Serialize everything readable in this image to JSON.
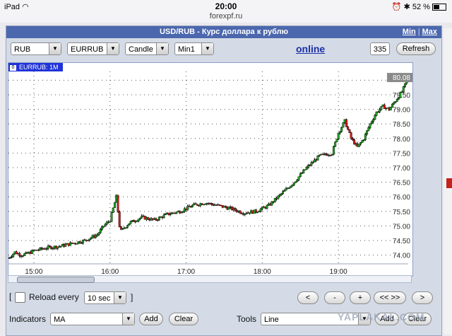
{
  "statusbar": {
    "device": "iPad",
    "time": "20:00",
    "url": "forexpf.ru",
    "battery": "52 %"
  },
  "window": {
    "title": "USD/RUB - Курс доллара к рублю",
    "min_link": "Min",
    "max_link": "Max"
  },
  "toolbar": {
    "selects": [
      {
        "name": "currency-select",
        "value": "RUB"
      },
      {
        "name": "pair-select",
        "value": "EURRUB"
      },
      {
        "name": "chart-type-select",
        "value": "Candle"
      },
      {
        "name": "timeframe-select",
        "value": "Min1"
      }
    ],
    "online_label": "online",
    "bars_count": "335",
    "refresh_label": "Refresh"
  },
  "chart": {
    "instrument_label": "EURRUB: 1M",
    "instrument_box": "0",
    "last_price": "80.08"
  },
  "chart_data": {
    "type": "candlestick",
    "x_ticks": [
      "15:00",
      "16:00",
      "17:00",
      "18:00",
      "19:00"
    ],
    "y_ticks": [
      "74.00",
      "74.50",
      "75.00",
      "75.50",
      "76.00",
      "76.50",
      "77.00",
      "77.50",
      "78.00",
      "78.50",
      "79.00",
      "79.50",
      "80.00"
    ],
    "ylim": [
      73.7,
      80.3
    ],
    "x_range": [
      "14:40",
      "19:55"
    ],
    "grid": true,
    "last_price": 80.08,
    "price_path": [
      [
        "14:40",
        73.9
      ],
      [
        "14:45",
        74.1
      ],
      [
        "14:50",
        74.0
      ],
      [
        "14:55",
        74.05
      ],
      [
        "15:00",
        74.15
      ],
      [
        "15:10",
        74.25
      ],
      [
        "15:20",
        74.3
      ],
      [
        "15:30",
        74.4
      ],
      [
        "15:40",
        74.5
      ],
      [
        "15:50",
        74.7
      ],
      [
        "15:55",
        75.0
      ],
      [
        "16:00",
        75.2
      ],
      [
        "16:05",
        76.0
      ],
      [
        "16:08",
        74.8
      ],
      [
        "16:15",
        75.1
      ],
      [
        "16:25",
        75.3
      ],
      [
        "16:35",
        75.2
      ],
      [
        "16:45",
        75.4
      ],
      [
        "16:55",
        75.5
      ],
      [
        "17:05",
        75.7
      ],
      [
        "17:15",
        75.8
      ],
      [
        "17:25",
        75.7
      ],
      [
        "17:35",
        75.6
      ],
      [
        "17:45",
        75.45
      ],
      [
        "17:55",
        75.5
      ],
      [
        "18:05",
        75.7
      ],
      [
        "18:15",
        76.1
      ],
      [
        "18:25",
        76.5
      ],
      [
        "18:35",
        77.0
      ],
      [
        "18:45",
        77.4
      ],
      [
        "18:55",
        77.5
      ],
      [
        "19:00",
        78.2
      ],
      [
        "19:05",
        78.6
      ],
      [
        "19:10",
        78.0
      ],
      [
        "19:15",
        77.7
      ],
      [
        "19:20",
        78.0
      ],
      [
        "19:25",
        78.5
      ],
      [
        "19:30",
        78.9
      ],
      [
        "19:35",
        79.1
      ],
      [
        "19:40",
        79.0
      ],
      [
        "19:45",
        79.3
      ],
      [
        "19:50",
        79.6
      ],
      [
        "19:55",
        80.08
      ]
    ]
  },
  "controls": {
    "reload_label": "Reload every",
    "reload_interval": "10 sec",
    "reload_close": "]",
    "nav_buttons": [
      "<",
      "-",
      "+",
      "<< >>",
      ">"
    ],
    "indicators_label": "Indicators",
    "indicator_value": "MA",
    "add_label": "Add",
    "clear_label": "Clear",
    "tools_label": "Tools",
    "tool_value": "Line",
    "tools_add_label": "Add",
    "tools_clear_label": "Clear"
  },
  "watermark": "YAPLAKAL.COM"
}
